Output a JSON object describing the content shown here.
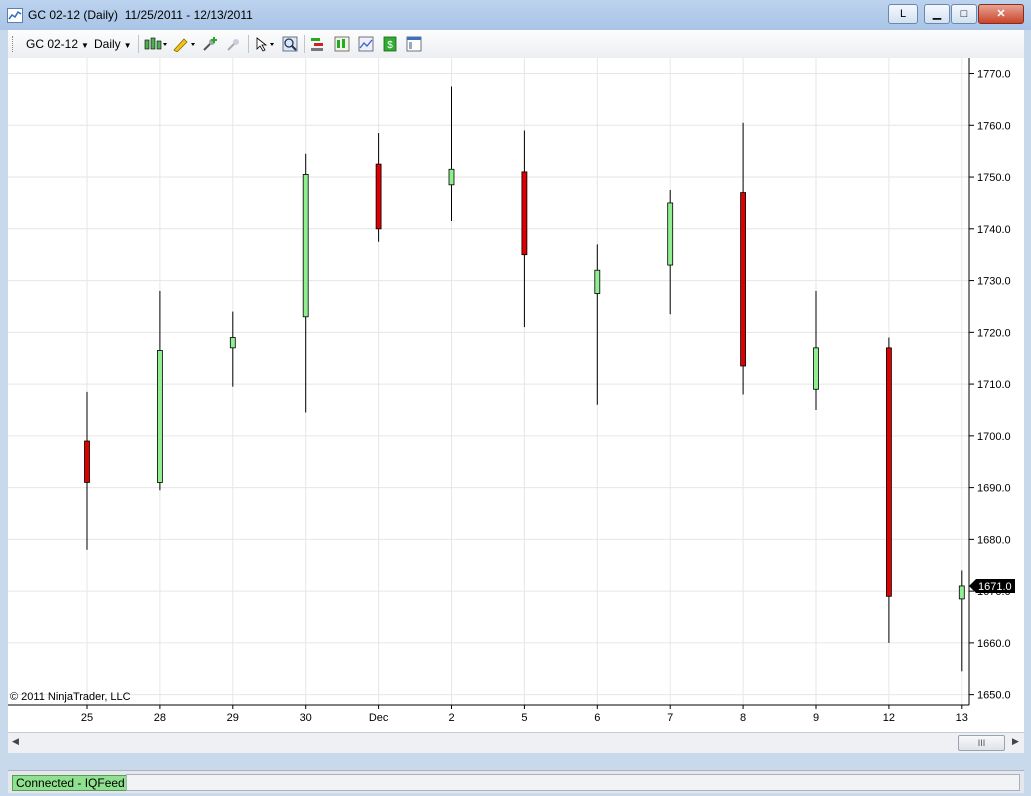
{
  "window": {
    "title": "GC 02-12 (Daily)  11/25/2011 - 12/13/2011",
    "btn_l": "L",
    "btn_min": "▁",
    "btn_max": "□",
    "btn_close": "✕"
  },
  "toolbar": {
    "instrument": "GC 02-12",
    "interval": "Daily",
    "icons": [
      "bar-type-icon",
      "drawing-tool-icon",
      "add-indicator-icon",
      "remove-indicator-icon",
      "pointer-icon",
      "zoom-icon",
      "strategy-icon",
      "chart-style-icon",
      "data-box-icon",
      "order-icon",
      "properties-icon"
    ]
  },
  "status": {
    "text": "Connected - IQFeed"
  },
  "copyright": "© 2011 NinjaTrader, LLC",
  "colors": {
    "up": "#90ee90",
    "down": "#dd0000",
    "wick": "#000000",
    "grid": "#e6e6e6",
    "last_price_bg": "#000000"
  },
  "chart_data": {
    "type": "candlestick",
    "title": "GC 02-12 (Daily)",
    "categories": [
      "25",
      "28",
      "29",
      "30",
      "Dec",
      "2",
      "5",
      "6",
      "7",
      "8",
      "9",
      "12",
      "13"
    ],
    "series": [
      {
        "open": [
          1699.0,
          1691.0,
          1717.0,
          1723.0,
          1752.5,
          1748.5,
          1751.0,
          1727.5,
          1733.0,
          1747.0,
          1709.0,
          1717.0,
          1668.5
        ],
        "high": [
          1708.5,
          1728.0,
          1724.0,
          1754.5,
          1758.5,
          1767.5,
          1759.0,
          1737.0,
          1747.5,
          1760.5,
          1728.0,
          1719.0,
          1674.0
        ],
        "low": [
          1678.0,
          1689.5,
          1709.5,
          1704.5,
          1737.5,
          1741.5,
          1721.0,
          1706.0,
          1723.5,
          1708.0,
          1705.0,
          1660.0,
          1654.5
        ],
        "close": [
          1691.0,
          1716.5,
          1719.0,
          1750.5,
          1740.0,
          1751.5,
          1735.0,
          1732.0,
          1745.0,
          1713.5,
          1717.0,
          1669.0,
          1671.0
        ]
      }
    ],
    "yticks": [
      "1650.0",
      "1660.0",
      "1670.0",
      "1680.0",
      "1690.0",
      "1700.0",
      "1710.0",
      "1720.0",
      "1730.0",
      "1740.0",
      "1750.0",
      "1760.0",
      "1770.0"
    ],
    "ylim": [
      1648,
      1773
    ],
    "last_price": "1671.0",
    "grid": true
  }
}
